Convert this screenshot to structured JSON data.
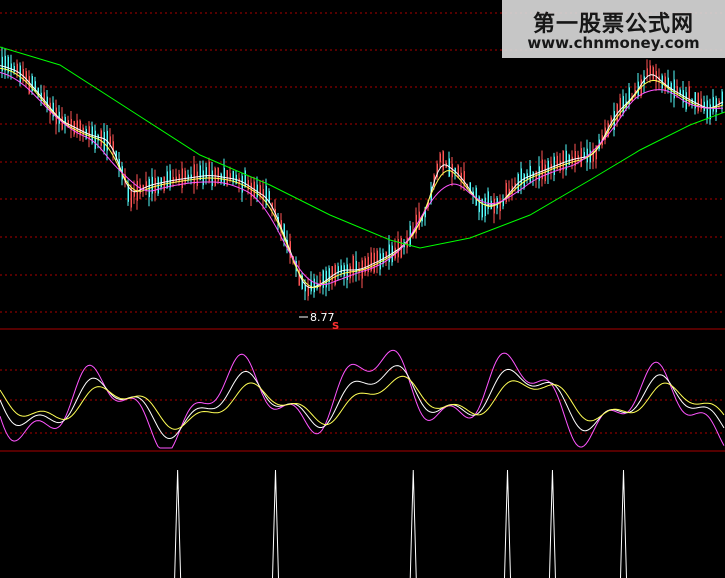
{
  "watermark": {
    "title": "第一股票公式网",
    "url": "www.chnmoney.com"
  },
  "colors": {
    "background": "#000000",
    "up_candle": "#ff5555",
    "down_candle": "#54fcfc",
    "ma_short": "#ffffff",
    "ma_mid": "#ffff55",
    "ma_long": "#ff55ff",
    "ma_longest": "#00ff00",
    "grid": "#aa0000",
    "osc_fast": "#ff55ff",
    "osc_slow": "#ffffff",
    "osc_mid": "#ffff55",
    "signal": "#ffffff",
    "sell_marker": "#ff3030"
  },
  "chart_data": [
    {
      "type": "candlestick",
      "panel": "price",
      "low_label": "8.77",
      "sell_marker": "S",
      "overlays": [
        "moving averages (4 lines)"
      ],
      "grid": true
    },
    {
      "type": "line",
      "panel": "oscillator",
      "series_count": 3,
      "grid": true
    },
    {
      "type": "bar",
      "panel": "signals",
      "signal_count": 6,
      "signal_positions_fraction": [
        0.245,
        0.38,
        0.57,
        0.7,
        0.762,
        0.86
      ]
    }
  ]
}
